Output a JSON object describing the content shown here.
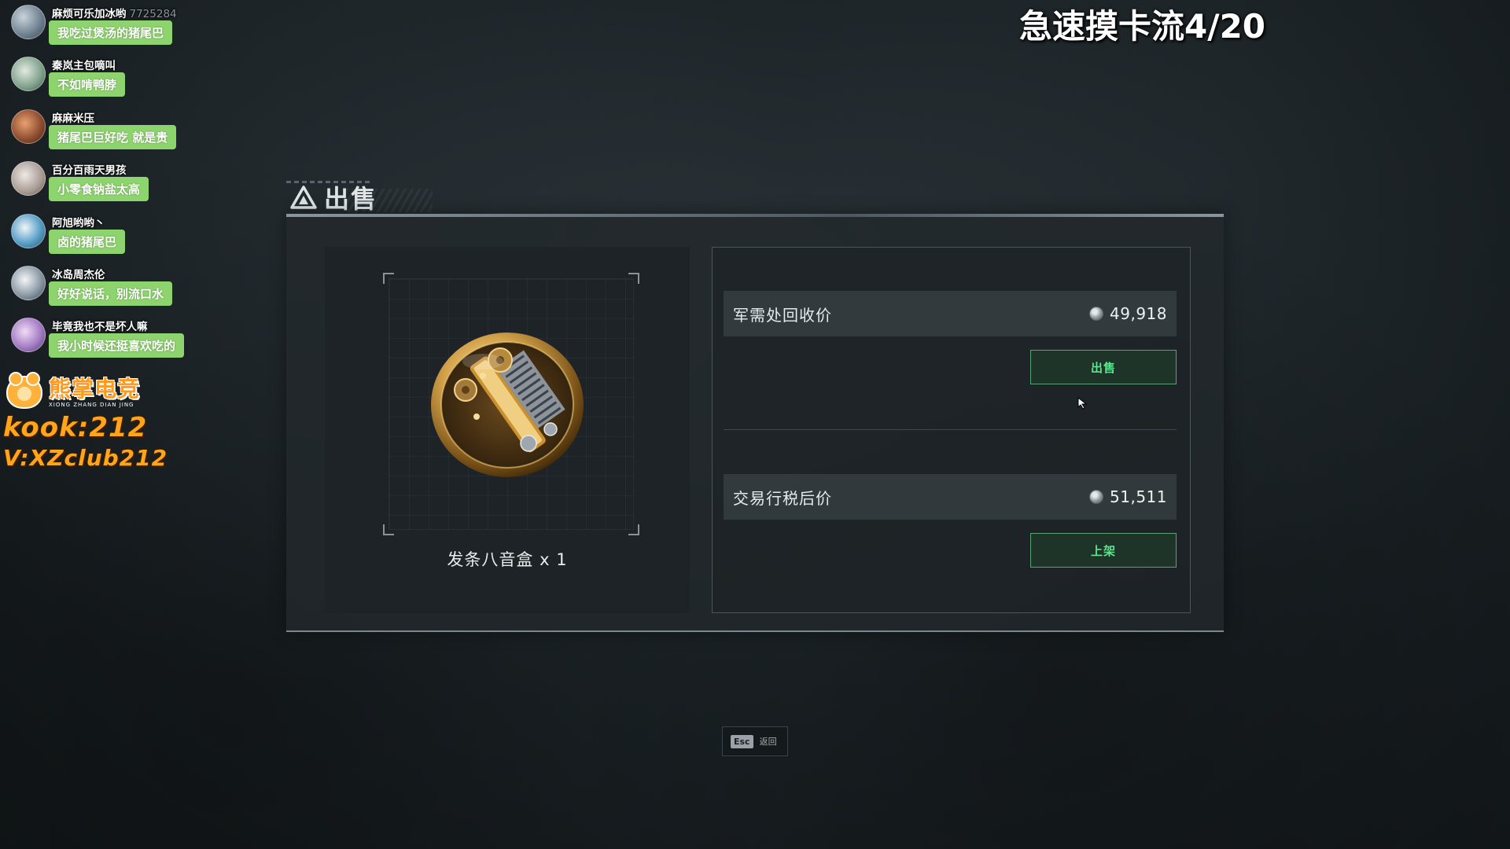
{
  "stream_title": "急速摸卡流4/20",
  "chat": [
    {
      "name": "麻烦可乐加冰哟",
      "uid": "7725284",
      "message": "我吃过煲汤的猪尾巴"
    },
    {
      "name": "秦岚主包嘀叫",
      "uid": "",
      "message": "不如啃鸭脖"
    },
    {
      "name": "麻麻米压",
      "uid": "",
      "message": "猪尾巴巨好吃 就是贵"
    },
    {
      "name": "百分百雨天男孩",
      "uid": "",
      "message": "小零食钠盐太高"
    },
    {
      "name": "阿旭哟哟丶",
      "uid": "",
      "message": "卤的猪尾巴"
    },
    {
      "name": "冰岛周杰伦",
      "uid": "",
      "message": "好好说话，别流口水"
    },
    {
      "name": "毕竟我也不是坏人嘛",
      "uid": "",
      "message": "我小时候还挺喜欢吃的"
    }
  ],
  "brand": {
    "name": "熊掌电竞",
    "pinyin": "XIONG ZHANG DIAN JING",
    "kook": "kook:212",
    "vx": "V:XZclub212",
    "accent_color": "#ffa51c"
  },
  "dialog": {
    "title": "出售",
    "title_icon": "warning-triangle-icon",
    "item": {
      "name": "发条八音盒 x 1",
      "icon": "music-box-icon"
    },
    "recycle": {
      "label": "军需处回收价",
      "value": "49,918",
      "currency_icon": "coin-icon",
      "button_label": "出售"
    },
    "market": {
      "label": "交易行税后价",
      "value": "51,511",
      "currency_icon": "coin-icon",
      "button_label": "上架"
    },
    "accent_color": "#5fe38e"
  },
  "footer": {
    "esc_key": "Esc",
    "esc_label": "返回"
  }
}
